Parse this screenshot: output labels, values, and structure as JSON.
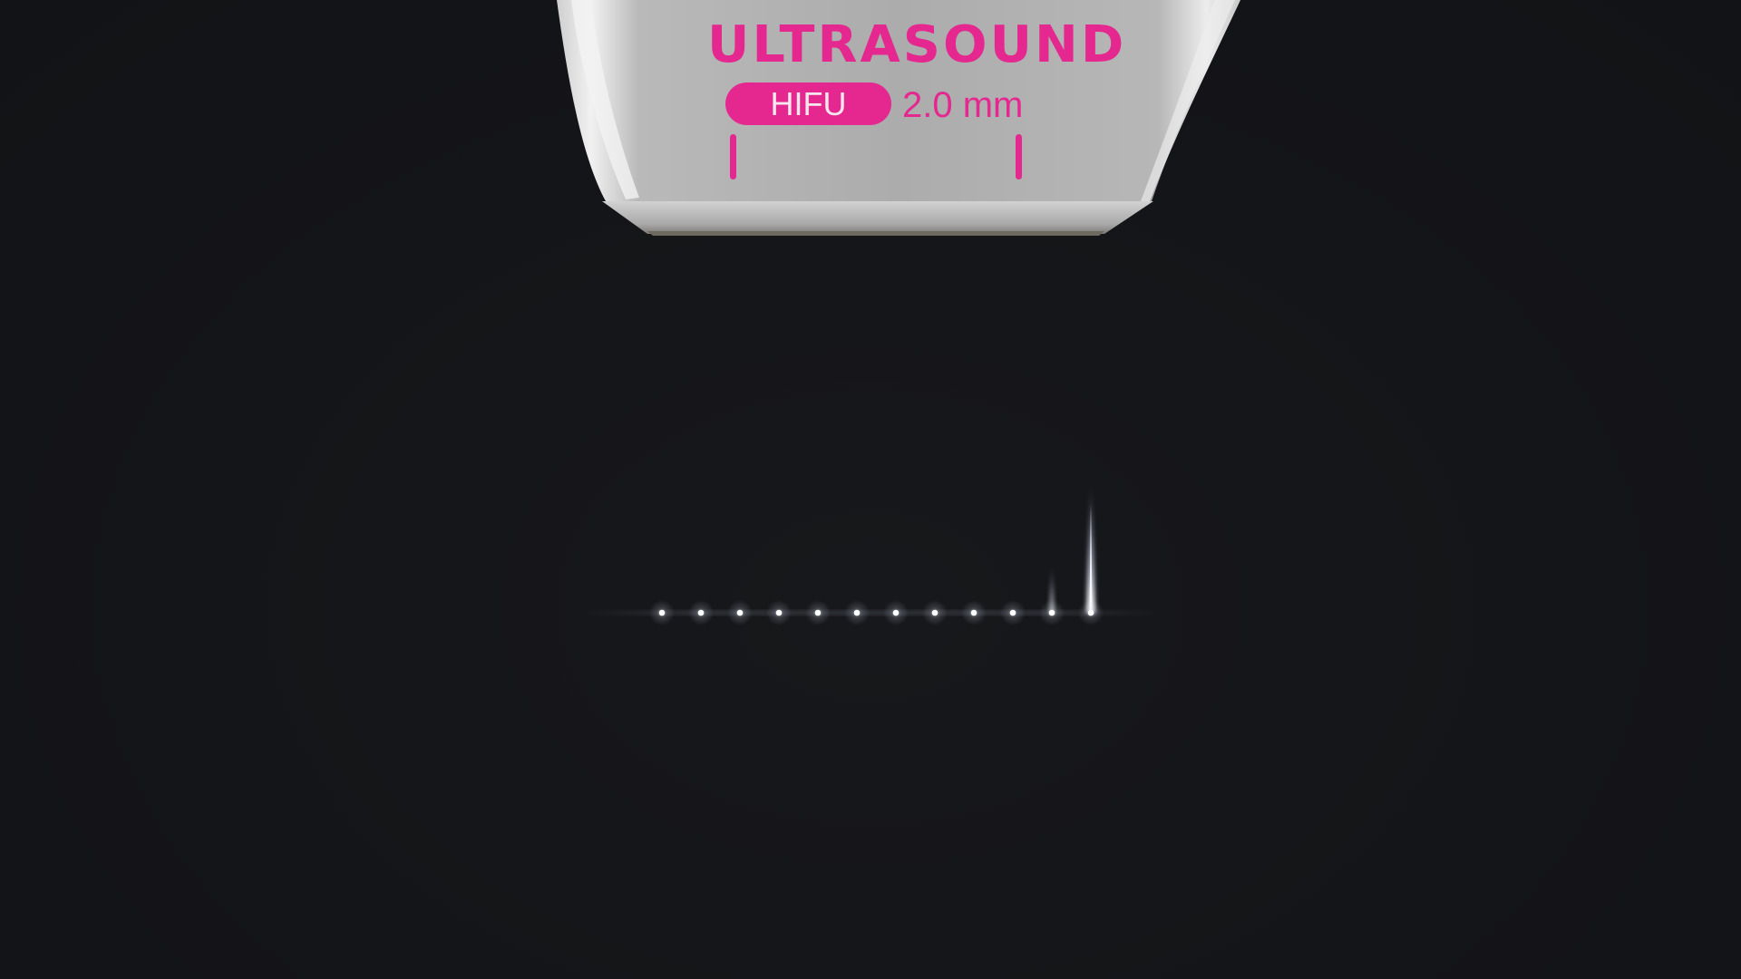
{
  "probe": {
    "brand": "ULTRASOUND",
    "mode_badge": "HIFU",
    "depth_label": "2.0 mm"
  },
  "colors": {
    "accent": "#e4288f",
    "background": "#141518",
    "probe_body": "#b3b3b3",
    "dot": "#ffffff"
  },
  "treatment_line": {
    "dot_count": 12,
    "active_dot_index": 11,
    "trailing_glow_dot_index": 10
  }
}
